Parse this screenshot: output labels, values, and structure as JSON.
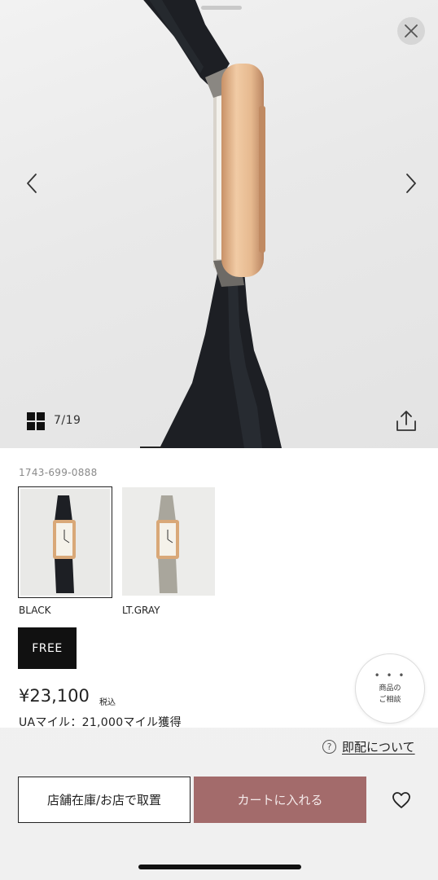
{
  "gallery": {
    "current_index": 7,
    "total": 19,
    "counter_text": "7/19",
    "image_alt": "watch side view"
  },
  "product": {
    "code": "1743-699-0888",
    "colors": [
      {
        "label": "BLACK",
        "strap_color": "#1d1f24",
        "selected": true
      },
      {
        "label": "LT.GRAY",
        "strap_color": "#a9a69c",
        "selected": false
      }
    ],
    "size": {
      "label": "FREE",
      "selected": true
    },
    "price": "¥23,100",
    "tax_label": "税込",
    "mile_text": "UAマイル：21,000マイル獲得"
  },
  "consult": {
    "dots": "• • •",
    "line1": "商品の",
    "line2": "ご相談"
  },
  "bottom_bar": {
    "delivery_icon": "?",
    "delivery_link": "即配について",
    "store_button": "店舗在庫/お店で取置",
    "cart_button": "カートに入れる"
  },
  "icons": {
    "close": "close-icon",
    "prev": "chevron-left-icon",
    "next": "chevron-right-icon",
    "grid": "grid-icon",
    "share": "share-icon",
    "favorite": "heart-icon",
    "help": "question-circle-icon"
  },
  "colors": {
    "cart_button": "#a36b6b",
    "size_selected": "#111111",
    "strap": "#1d1f24",
    "case_gold": "#e6b98f"
  }
}
